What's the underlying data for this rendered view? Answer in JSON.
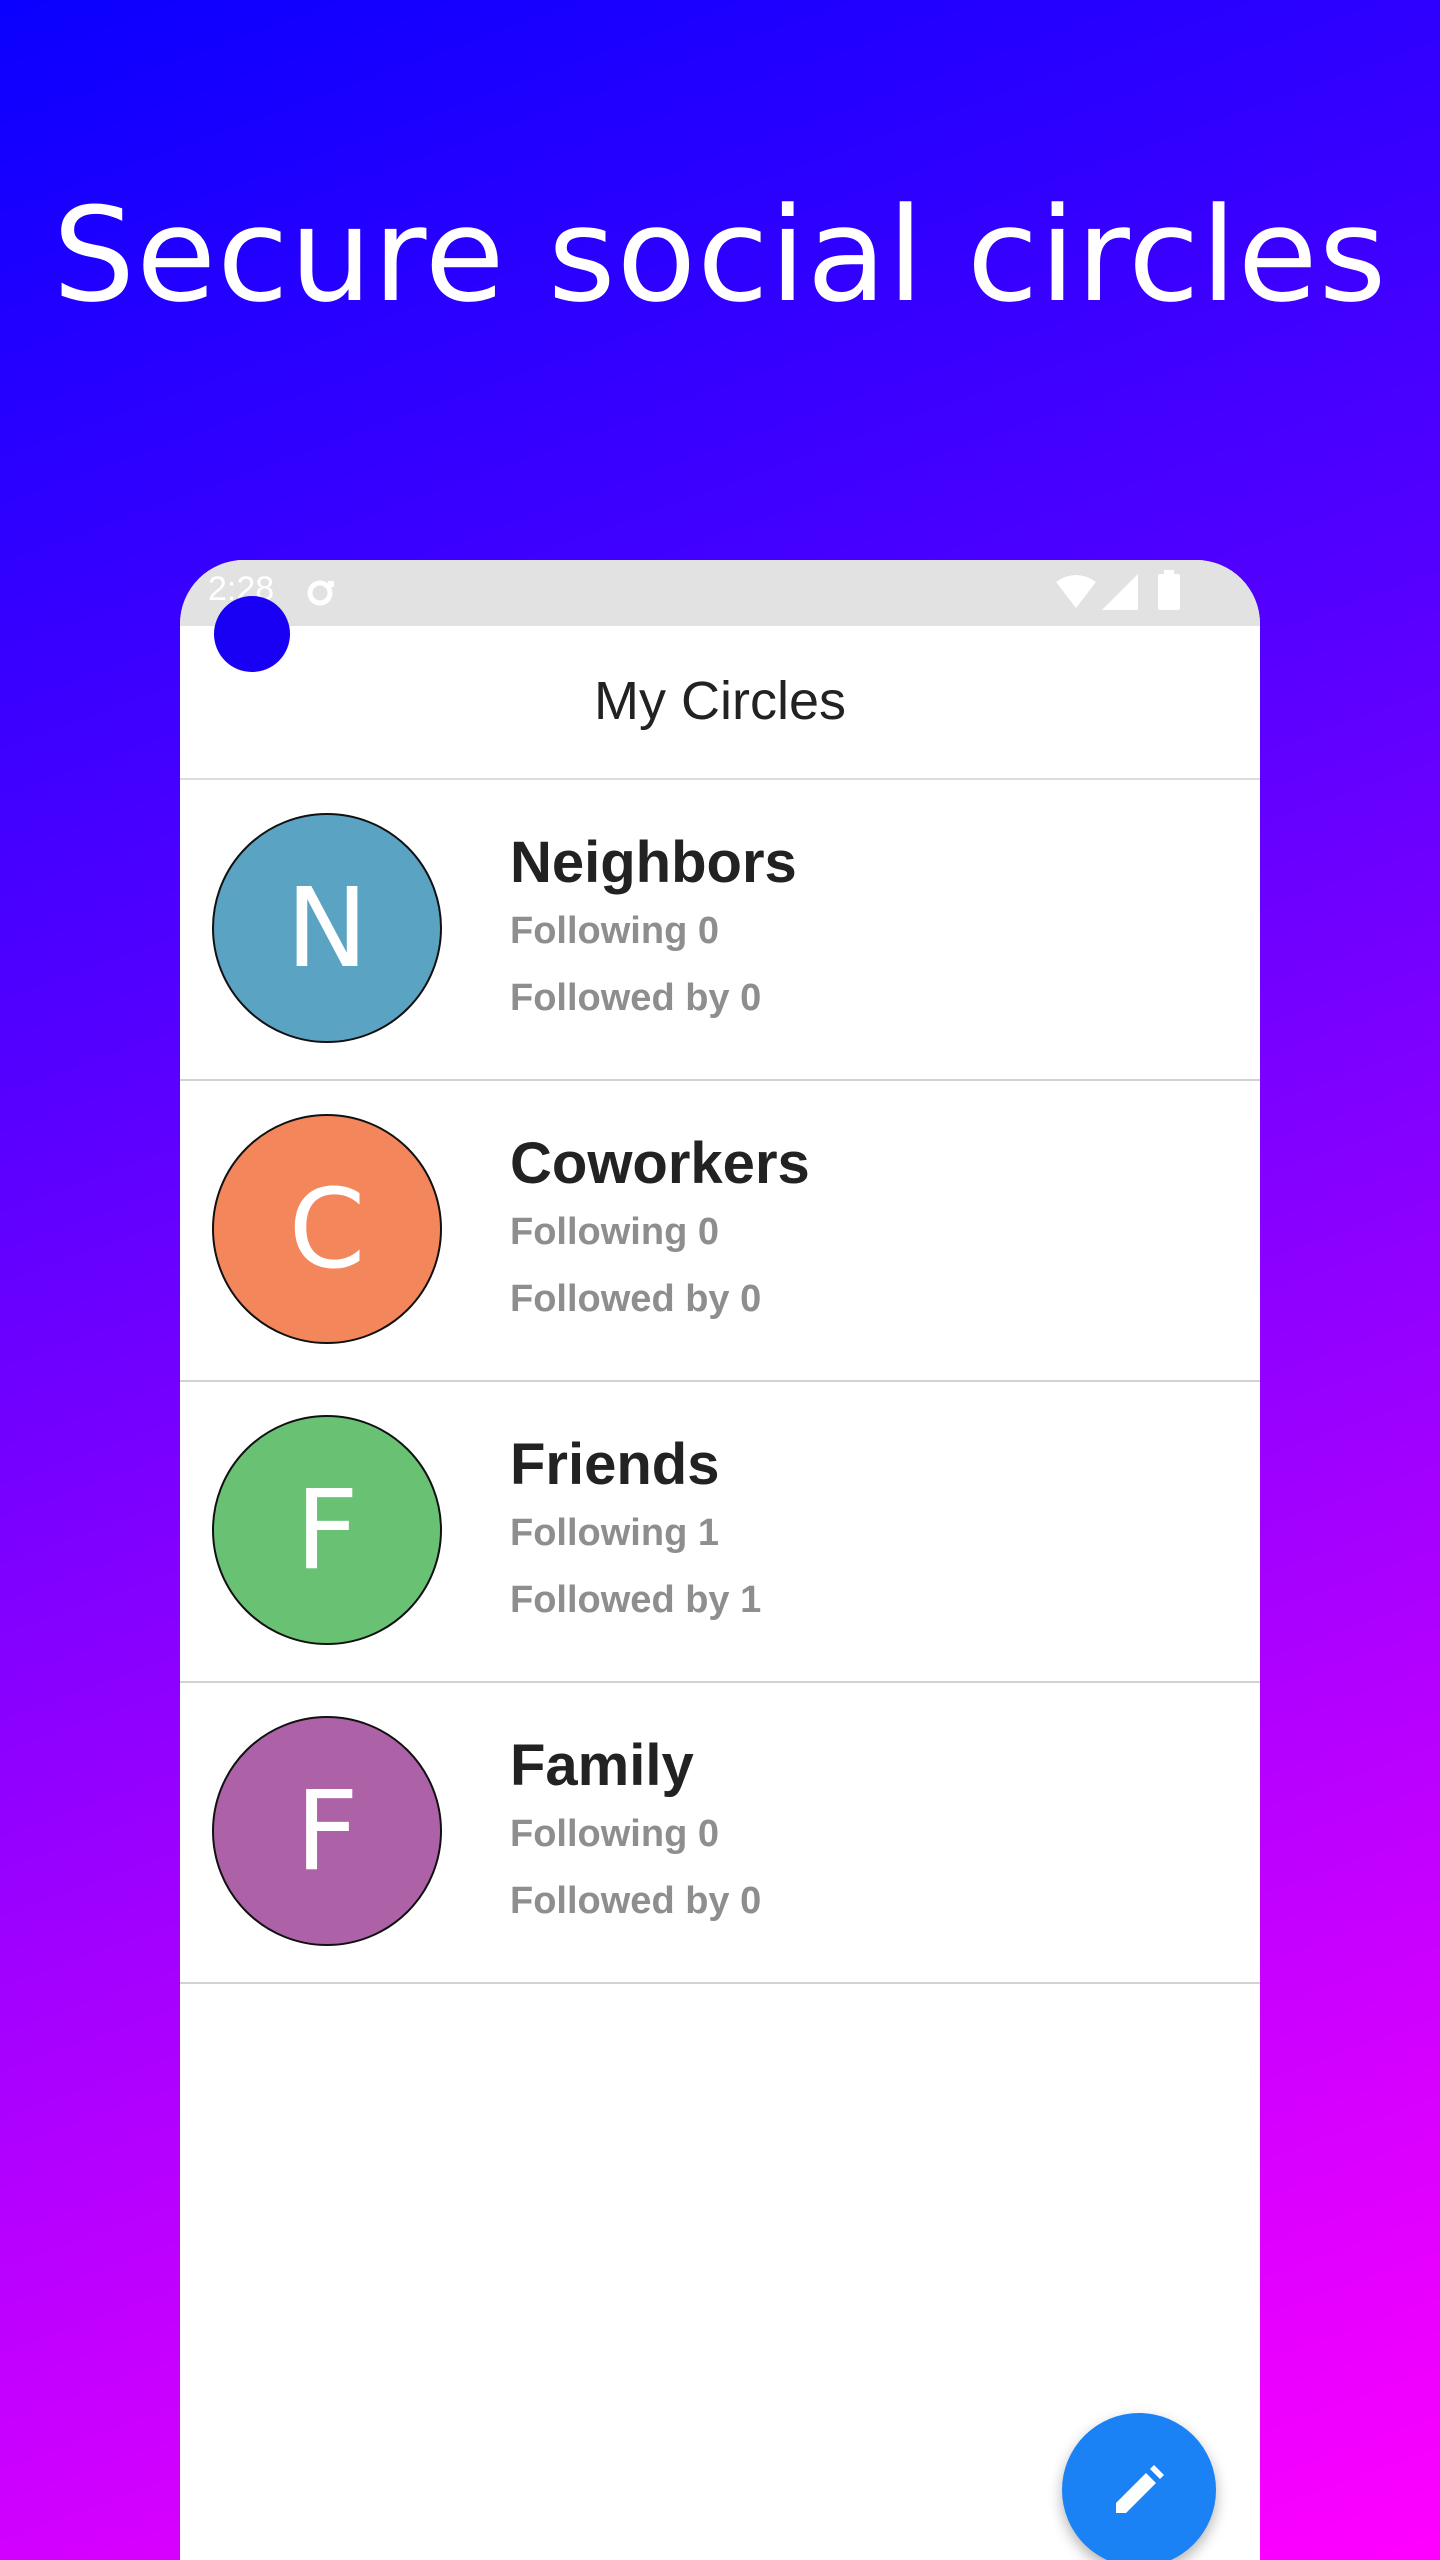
{
  "headline": "Secure social circles",
  "status_bar": {
    "time": "2:28",
    "icons": [
      "sync-icon",
      "wifi-icon",
      "signal-icon",
      "battery-icon"
    ]
  },
  "app_bar": {
    "title": "My Circles"
  },
  "circles": [
    {
      "initial": "N",
      "name": "Neighbors",
      "following": "Following 0",
      "followed_by": "Followed by 0",
      "color": "#5ba3c3"
    },
    {
      "initial": "C",
      "name": "Coworkers",
      "following": "Following 0",
      "followed_by": "Followed by 0",
      "color": "#f4865b"
    },
    {
      "initial": "F",
      "name": "Friends",
      "following": "Following 1",
      "followed_by": "Followed by 1",
      "color": "#69c274"
    },
    {
      "initial": "F",
      "name": "Family",
      "following": "Following 0",
      "followed_by": "Followed by 0",
      "color": "#ad62a8"
    }
  ],
  "fab": {
    "icon": "pencil-icon",
    "color": "#1a82f5"
  },
  "colors": {
    "gradient_start": "#0a00ff",
    "gradient_end": "#ff00ff"
  }
}
